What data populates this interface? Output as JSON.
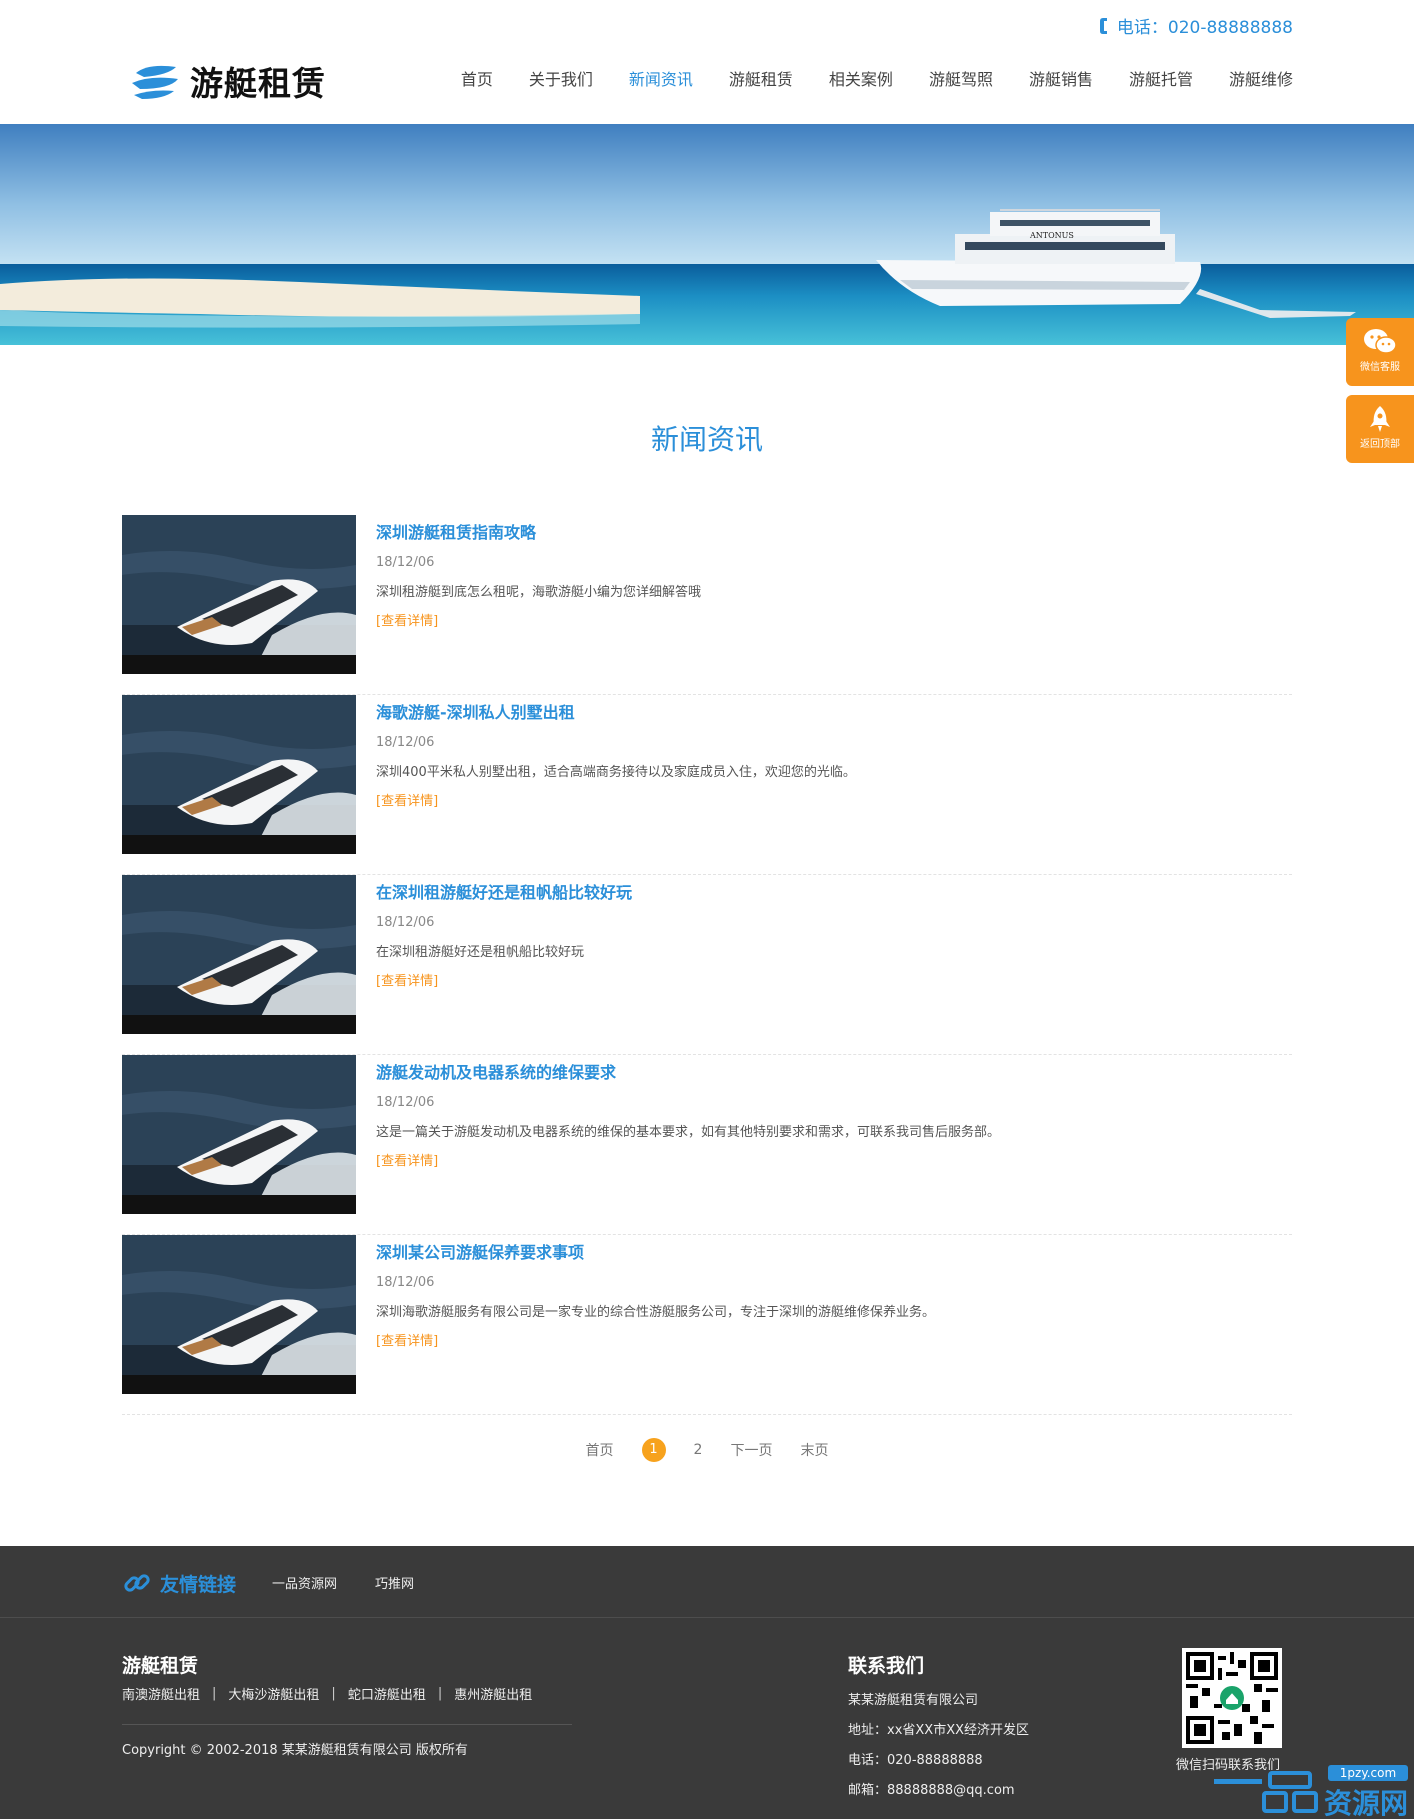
{
  "header": {
    "phone": "电话：020-88888888",
    "logo_text": "游艇租赁",
    "nav": [
      {
        "label": "首页",
        "active": false
      },
      {
        "label": "关于我们",
        "active": false
      },
      {
        "label": "新闻资讯",
        "active": true
      },
      {
        "label": "游艇租赁",
        "active": false
      },
      {
        "label": "相关案例",
        "active": false
      },
      {
        "label": "游艇驾照",
        "active": false
      },
      {
        "label": "游艇销售",
        "active": false
      },
      {
        "label": "游艇托管",
        "active": false
      },
      {
        "label": "游艇维修",
        "active": false
      }
    ]
  },
  "banner": {
    "boat_name": "ANTONUS"
  },
  "floats": {
    "wechat_label": "微信客服",
    "top_label": "返回顶部"
  },
  "section_title": "新闻资讯",
  "news": [
    {
      "title": "深圳游艇租赁指南攻略",
      "date": "18/12/06",
      "desc": "深圳租游艇到底怎么租呢，海歌游艇小编为您详细解答哦",
      "more": "[查看详情]"
    },
    {
      "title": "海歌游艇-深圳私人别墅出租",
      "date": "18/12/06",
      "desc": "深圳400平米私人别墅出租，适合高端商务接待以及家庭成员入住，欢迎您的光临。",
      "more": "[查看详情]"
    },
    {
      "title": "在深圳租游艇好还是租帆船比较好玩",
      "date": "18/12/06",
      "desc": "在深圳租游艇好还是租帆船比较好玩",
      "more": "[查看详情]"
    },
    {
      "title": "游艇发动机及电器系统的维保要求",
      "date": "18/12/06",
      "desc": "这是一篇关于游艇发动机及电器系统的维保的基本要求，如有其他特别要求和需求，可联系我司售后服务部。",
      "more": "[查看详情]"
    },
    {
      "title": "深圳某公司游艇保养要求事项",
      "date": "18/12/06",
      "desc": "深圳海歌游艇服务有限公司是一家专业的综合性游艇服务公司，专注于深圳的游艇维修保养业务。",
      "more": "[查看详情]"
    }
  ],
  "pagination": {
    "first": "首页",
    "current": "1",
    "page2": "2",
    "next": "下一页",
    "last": "末页"
  },
  "friend_links": {
    "title": "友情链接",
    "items": [
      "一品资源网",
      "巧推网"
    ]
  },
  "footer": {
    "brand": "游艇租赁",
    "cities": [
      "南澳游艇出租",
      "大梅沙游艇出租",
      "蛇口游艇出租",
      "惠州游艇出租"
    ],
    "separator": "|",
    "copyright": "Copyright © 2002-2018 某某游艇租赁有限公司 版权所有",
    "contact_title": "联系我们",
    "company": "某某游艇租赁有限公司",
    "address": "地址：xx省XX市XX经济开发区",
    "tel": "电话：020-88888888",
    "email": "邮箱：88888888@qq.com",
    "qr_caption": "微信扫码联系我们"
  },
  "watermark": {
    "domain": "1pzy.com",
    "text": "资源网"
  },
  "colors": {
    "brand_blue": "#2b8fd9",
    "accent_orange": "#f7941d",
    "footer_bg": "#3a3a3a"
  }
}
